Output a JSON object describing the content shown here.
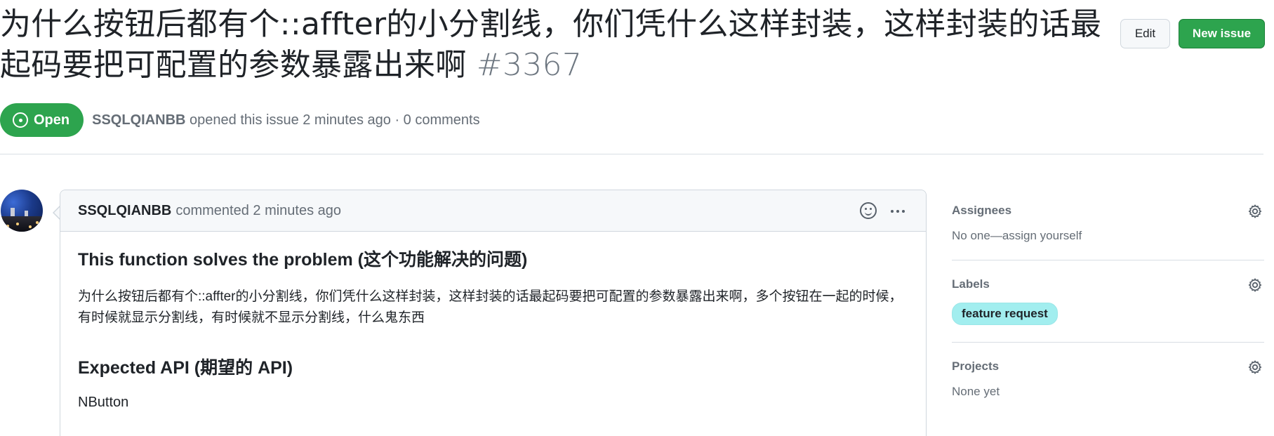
{
  "issue": {
    "title": "为什么按钮后都有个::affter的小分割线，你们凭什么这样封装，这样封装的话最起码要把可配置的参数暴露出来啊",
    "number": "#3367",
    "state": "Open",
    "author": "SSQLQIANBB",
    "opened_text": "opened this issue 2 minutes ago · 0 comments"
  },
  "header_actions": {
    "edit_label": "Edit",
    "new_issue_label": "New issue"
  },
  "comment": {
    "author": "SSQLQIANBB",
    "time_text": "commented 2 minutes ago",
    "heading1": "This function solves the problem (这个功能解决的问题)",
    "paragraph": "为什么按钮后都有个::affter的小分割线，你们凭什么这样封装，这样封装的话最起码要把可配置的参数暴露出来啊，多个按钮在一起的时候，有时候就显示分割线，有时候就不显示分割线，什么鬼东西",
    "heading2": "Expected API (期望的 API)",
    "api_text": "NButton"
  },
  "sidebar": {
    "assignees": {
      "heading": "Assignees",
      "value": "No one—assign yourself"
    },
    "labels": {
      "heading": "Labels",
      "items": [
        "feature request"
      ]
    },
    "projects": {
      "heading": "Projects",
      "value": "None yet"
    }
  },
  "colors": {
    "open_green": "#2da44e",
    "label_bg": "#a2eeef"
  },
  "icons": [
    "issue-opened-icon",
    "smiley-icon",
    "kebab-icon",
    "gear-icon"
  ]
}
